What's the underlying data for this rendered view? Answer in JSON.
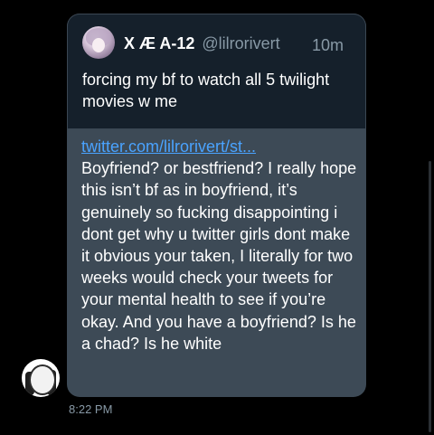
{
  "quoted_tweet": {
    "display_name": "X Æ A-12",
    "handle": "@lilrorivert",
    "time": "10m",
    "text": "forcing my bf to watch all 5 twilight movies w me"
  },
  "message": {
    "link": "twitter.com/lilrorivert/st...",
    "text": "Boyfriend? or bestfriend? I really hope this isn’t bf as in boyfriend, it’s genuinely so fucking disappointing i dont get why u twitter girls dont make it obvious your taken, I literally for two weeks would check your tweets for your mental health to see if you’re okay. And you have a boyfriend? Is he a chad? Is he white",
    "timestamp": "8:22 PM"
  },
  "colors": {
    "background": "#000000",
    "bubble": "#3d4a56",
    "quoted_card": "#15202b",
    "link": "#4aa3ff",
    "muted_text": "#8899a6"
  }
}
